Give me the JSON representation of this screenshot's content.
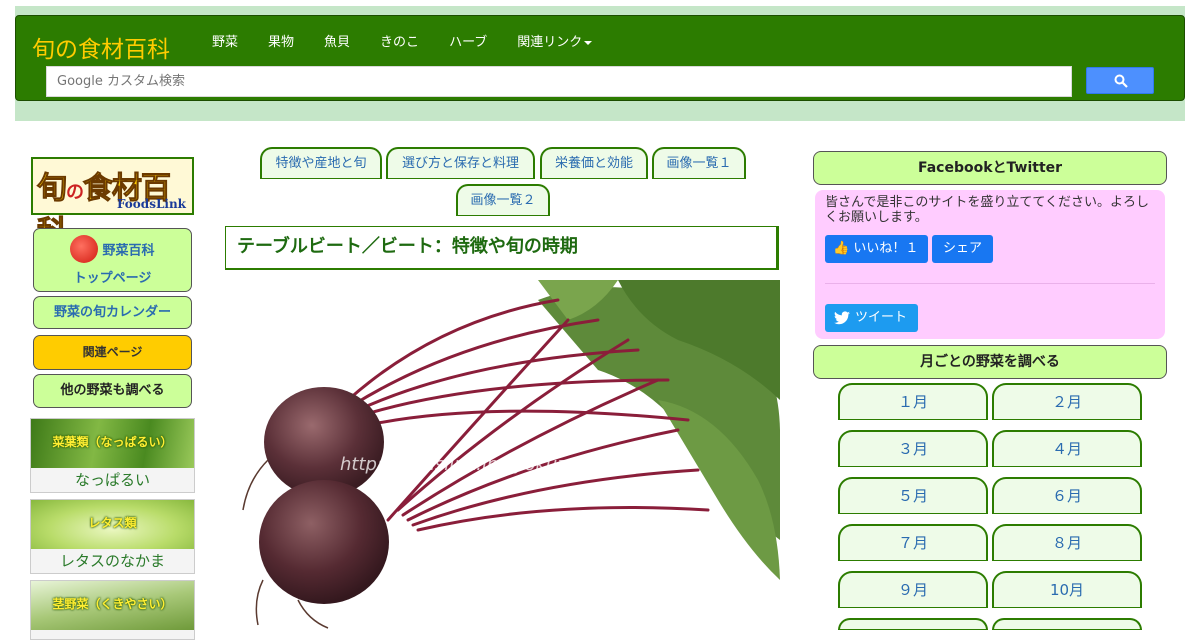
{
  "header": {
    "brand": "旬の食材百科",
    "menu": [
      {
        "label": "野菜"
      },
      {
        "label": "果物"
      },
      {
        "label": "魚貝"
      },
      {
        "label": "きのこ"
      },
      {
        "label": "ハーブ"
      },
      {
        "label": "関連リンク"
      }
    ],
    "search_placeholder": "Google カスタム検索"
  },
  "sidebar": {
    "logo_text": "旬の食材百科",
    "logo_sub": "FoodsLink",
    "home_line1": "野菜百科",
    "home_line2": "トップページ",
    "calendar": "野菜の旬カレンダー",
    "related": "関連ページ",
    "other": "他の野菜も調べる",
    "categories": [
      {
        "tag": "菜葉類（なっぱるい）",
        "caption": "なっぱるい"
      },
      {
        "tag": "レタス類",
        "caption": "レタスのなかま"
      },
      {
        "tag": "茎野菜（くきやさい）",
        "caption": ""
      }
    ]
  },
  "main": {
    "tabs": [
      {
        "label": "特徴や産地と旬"
      },
      {
        "label": "選び方と保存と料理"
      },
      {
        "label": "栄養価と効能"
      },
      {
        "label": "画像一覧１"
      },
      {
        "label": "画像一覧２"
      }
    ],
    "title": "テーブルビート／ビート：特徴や旬の時期",
    "watermark": "http://foodslink.jp/syokuzaihyakka/"
  },
  "right": {
    "fb_header": "FacebookとTwitter",
    "fb_message": "皆さんで是非このサイトを盛り立ててください。よろしくお願いします。",
    "like_label": "いいね！１",
    "share_label": "シェア",
    "tweet_label": "ツイート",
    "month_header": "月ごとの野菜を調べる",
    "months": [
      "１月",
      "２月",
      "３月",
      "４月",
      "５月",
      "６月",
      "７月",
      "８月",
      "９月",
      "10月"
    ]
  },
  "colors": {
    "navbar": "#2c7c00",
    "brand": "#ffcc00",
    "button_green": "#ccff99",
    "related_yellow": "#ffcc00",
    "fb_pink": "#ffccff",
    "facebook_blue": "#1877f2",
    "twitter_blue": "#1d9bf0"
  }
}
